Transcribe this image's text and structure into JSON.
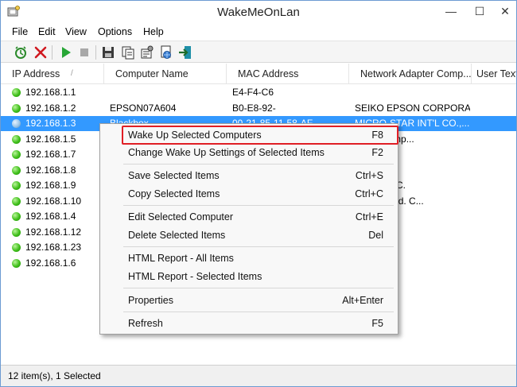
{
  "window": {
    "title": "WakeMeOnLan",
    "minimize_glyph": "—",
    "maximize_glyph": "☐",
    "close_glyph": "✕"
  },
  "menubar": [
    "File",
    "Edit",
    "View",
    "Options",
    "Help"
  ],
  "toolbar": {
    "buttons": [
      "options-icon",
      "delete-icon",
      "start-scan-icon",
      "stop-scan-icon",
      "save-icon",
      "copy-icon",
      "properties-icon",
      "html-report-icon",
      "exit-icon"
    ]
  },
  "columns": [
    "IP Address",
    "Computer Name",
    "MAC Address",
    "Network Adapter Comp...",
    "User Text"
  ],
  "sort_indicator": "/",
  "rows": [
    {
      "ip": "192.168.1.1",
      "name": "",
      "mac": "E4-F4-C6",
      "vendor": "",
      "selected": false
    },
    {
      "ip": "192.168.1.2",
      "name": "EPSON07A604",
      "mac": "B0-E8-92-",
      "vendor": "SEIKO EPSON CORPORA...",
      "selected": false
    },
    {
      "ip": "192.168.1.3",
      "name": "Blackbox",
      "mac": "00-21-85-11-58-AF",
      "vendor": "MICRO-STAR INT'L CO.,...",
      "selected": true
    },
    {
      "ip": "192.168.1.5",
      "name": "",
      "mac": "",
      "vendor": "ckard Comp...",
      "selected": false
    },
    {
      "ip": "192.168.1.7",
      "name": "",
      "mac": "",
      "vendor": "",
      "selected": false
    },
    {
      "ip": "192.168.1.8",
      "name": "",
      "mac": "",
      "vendor": "",
      "selected": false
    },
    {
      "ip": "192.168.1.9",
      "name": "",
      "mac": "",
      "vendor": "TEMS, INC.",
      "selected": false
    },
    {
      "ip": "192.168.1.10",
      "name": "",
      "mac": "",
      "vendor": "recision Ind. C...",
      "selected": false
    },
    {
      "ip": "192.168.1.4",
      "name": "",
      "mac": "",
      "vendor": "orate",
      "selected": false
    },
    {
      "ip": "192.168.1.12",
      "name": "",
      "mac": "",
      "vendor": "",
      "selected": false
    },
    {
      "ip": "192.168.1.23",
      "name": "",
      "mac": "",
      "vendor": "",
      "selected": false
    },
    {
      "ip": "192.168.1.6",
      "name": "",
      "mac": "",
      "vendor": "",
      "selected": false
    }
  ],
  "context_menu": {
    "items": [
      {
        "label": "Wake Up Selected Computers",
        "shortcut": "F8",
        "highlighted": true
      },
      {
        "label": "Change Wake Up Settings of Selected Items",
        "shortcut": "F2"
      },
      {
        "label": "Save Selected Items",
        "shortcut": "Ctrl+S"
      },
      {
        "label": "Copy Selected Items",
        "shortcut": "Ctrl+C"
      },
      {
        "label": "Edit Selected Computer",
        "shortcut": "Ctrl+E"
      },
      {
        "label": "Delete Selected Items",
        "shortcut": "Del"
      },
      {
        "label": "HTML Report - All Items",
        "shortcut": ""
      },
      {
        "label": "HTML Report - Selected Items",
        "shortcut": ""
      },
      {
        "label": "Properties",
        "shortcut": "Alt+Enter"
      },
      {
        "label": "Refresh",
        "shortcut": "F5"
      }
    ]
  },
  "status": {
    "text": "12 item(s), 1 Selected"
  },
  "colors": {
    "selection": "#3399ff",
    "highlight_border": "#e01e25",
    "status_online": "#3fbf1a"
  }
}
